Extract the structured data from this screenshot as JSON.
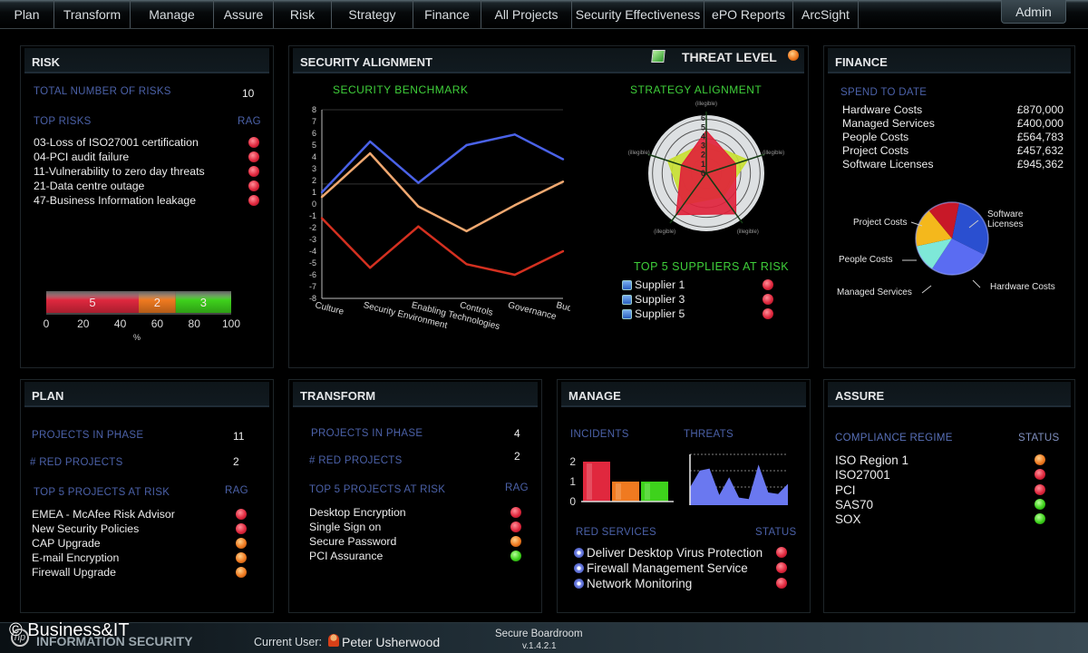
{
  "nav": {
    "tabs": [
      "Plan",
      "Transform",
      "Manage",
      "Assure",
      "Risk",
      "Strategy",
      "Finance",
      "All Projects",
      "Security Effectiveness",
      "ePO Reports",
      "ArcSight"
    ],
    "admin_label": "Admin"
  },
  "risk": {
    "title": "RISK",
    "total_label": "TOTAL NUMBER OF RISKS",
    "total_value": "10",
    "top_label": "TOP RISKS",
    "rag_label": "RAG",
    "items": [
      {
        "label": "03-Loss of ISO27001 certification",
        "status": "red"
      },
      {
        "label": "04-PCI audit failure",
        "status": "red"
      },
      {
        "label": "11-Vulnerability to zero day threats",
        "status": "red"
      },
      {
        "label": "21-Data centre outage",
        "status": "red"
      },
      {
        "label": "47-Business Information leakage",
        "status": "red"
      }
    ],
    "rag_bar": {
      "segments": [
        {
          "label": "5",
          "value": 5,
          "percent": 50,
          "color": "#e0283e"
        },
        {
          "label": "2",
          "value": 2,
          "percent": 20,
          "color": "#f07a20"
        },
        {
          "label": "3",
          "value": 3,
          "percent": 30,
          "color": "#3ed21c"
        }
      ],
      "ticks": [
        "0",
        "20",
        "40",
        "60",
        "80",
        "100"
      ],
      "xlabel": "%"
    }
  },
  "alignment": {
    "title": "SECURITY ALIGNMENT",
    "threat_label": "THREAT LEVEL",
    "threat_status": "amber",
    "benchmark_title": "SECURITY BENCHMARK",
    "strategy_title": "STRATEGY ALIGNMENT",
    "suppliers_title": "TOP 5 SUPPLIERS AT RISK",
    "suppliers": [
      {
        "label": "Supplier 1",
        "status": "red"
      },
      {
        "label": "Supplier 3",
        "status": "red"
      },
      {
        "label": "Supplier 5",
        "status": "red"
      }
    ]
  },
  "chart_data": [
    {
      "type": "line",
      "title": "SECURITY BENCHMARK",
      "categories": [
        "Culture",
        "Security Environment",
        "Enabling Technologies",
        "Controls",
        "Governance",
        "Budget"
      ],
      "ylim": [
        -8,
        8
      ],
      "yticks": [
        "8",
        "7",
        "6",
        "5",
        "4",
        "3",
        "2",
        "1",
        "0",
        "-1",
        "-2",
        "-3",
        "-4",
        "-5",
        "-6",
        "-7",
        "-8"
      ],
      "series": [
        {
          "name": "blue",
          "color": "#4a62e8",
          "values": [
            1,
            5.3,
            1.8,
            5,
            5.9,
            3.8
          ]
        },
        {
          "name": "orange",
          "color": "#f0a870",
          "values": [
            0.6,
            4.3,
            -0.2,
            -2.3,
            -0.1,
            1.9
          ]
        },
        {
          "name": "red",
          "color": "#d43020",
          "values": [
            -1.2,
            -5.4,
            -1.9,
            -5.1,
            -6,
            -4
          ]
        }
      ],
      "reference_line": 1.7
    },
    {
      "type": "radar",
      "title": "STRATEGY ALIGNMENT",
      "axes": [
        "(illegible)",
        "(illegible)",
        "(illegible)",
        "(illegible)",
        "(illegible)"
      ],
      "rings": [
        "0",
        "1",
        "2",
        "3",
        "4",
        "5",
        "6"
      ],
      "series": [
        {
          "name": "target",
          "color": "#c8e030",
          "values": [
            3.2,
            4.5,
            3,
            4,
            4.2
          ]
        },
        {
          "name": "actual",
          "color": "#e0203a",
          "values": [
            4.4,
            3.2,
            5.2,
            5.3,
            2.7
          ]
        }
      ]
    },
    {
      "type": "pie",
      "title": "SPEND TO DATE",
      "labels": [
        "Software Licenses",
        "Hardware Costs",
        "Managed Services",
        "People Costs",
        "Project Costs"
      ],
      "values": [
        945362,
        870000,
        400000,
        564783,
        457632
      ],
      "colors": [
        "#2a4fd0",
        "#5a6cf2",
        "#7ee8d8",
        "#f4b81c",
        "#c81828"
      ]
    },
    {
      "type": "bar",
      "title": "INCIDENTS",
      "categories": [
        "Red",
        "Amber",
        "Green"
      ],
      "values": [
        2,
        1,
        1
      ],
      "colors": [
        "#e0283e",
        "#f07a20",
        "#3ed21c"
      ],
      "yticks": [
        "0",
        "1",
        "2"
      ],
      "ylim": [
        0,
        2
      ]
    },
    {
      "type": "area",
      "title": "THREATS",
      "values": [
        0.35,
        0.68,
        0.72,
        0.2,
        0.55,
        0.15,
        0.12,
        0.8,
        0.25,
        0.22,
        0.42
      ],
      "ylim": [
        0,
        1
      ],
      "color": "#6a78f0"
    }
  ],
  "finance": {
    "title": "FINANCE",
    "spend_label": "SPEND TO DATE",
    "rows": [
      {
        "label": "Hardware Costs",
        "value": "£870,000"
      },
      {
        "label": "Managed Services",
        "value": "£400,000"
      },
      {
        "label": "People Costs",
        "value": "£564,783"
      },
      {
        "label": "Project Costs",
        "value": "£457,632"
      },
      {
        "label": "Software Licenses",
        "value": "£945,362"
      }
    ],
    "pie_labels": {
      "project": "Project Costs",
      "software1": "Software",
      "software2": "Licenses",
      "people": "People Costs",
      "managed": "Managed Services",
      "hardware": "Hardware Costs"
    }
  },
  "plan": {
    "title": "PLAN",
    "phase_label": "PROJECTS IN PHASE",
    "phase_value": "11",
    "red_label": "# RED PROJECTS",
    "red_value": "2",
    "top_label": "TOP 5 PROJECTS AT RISK",
    "rag_label": "RAG",
    "items": [
      {
        "label": "EMEA - McAfee Risk Advisor",
        "status": "red"
      },
      {
        "label": "New Security Policies",
        "status": "red"
      },
      {
        "label": "CAP Upgrade",
        "status": "amber"
      },
      {
        "label": "E-mail Encryption",
        "status": "amber"
      },
      {
        "label": "Firewall Upgrade",
        "status": "amber"
      }
    ]
  },
  "transform": {
    "title": "TRANSFORM",
    "phase_label": "PROJECTS IN PHASE",
    "phase_value": "4",
    "red_label": "# RED PROJECTS",
    "red_value": "2",
    "top_label": "TOP 5 PROJECTS AT RISK",
    "rag_label": "RAG",
    "items": [
      {
        "label": "Desktop Encryption",
        "status": "red"
      },
      {
        "label": "Single Sign on",
        "status": "red"
      },
      {
        "label": "Secure Password",
        "status": "amber"
      },
      {
        "label": "PCI Assurance",
        "status": "green"
      }
    ]
  },
  "manage": {
    "title": "MANAGE",
    "incidents_label": "INCIDENTS",
    "threats_label": "THREATS",
    "services_label": "RED SERVICES",
    "status_label": "STATUS",
    "services": [
      {
        "label": "Deliver Desktop Virus Protection",
        "status": "red"
      },
      {
        "label": "Firewall Management Service",
        "status": "red"
      },
      {
        "label": "Network Monitoring",
        "status": "red"
      }
    ]
  },
  "assure": {
    "title": "ASSURE",
    "regime_label": "COMPLIANCE REGIME",
    "status_label": "STATUS",
    "items": [
      {
        "label": "ISO Region 1",
        "status": "amber"
      },
      {
        "label": "ISO27001",
        "status": "red"
      },
      {
        "label": "PCI",
        "status": "red"
      },
      {
        "label": "SAS70",
        "status": "green"
      },
      {
        "label": "SOX",
        "status": "green"
      }
    ]
  },
  "footer": {
    "watermark": "© Business&IT",
    "app_name": "INFORMATION SECURITY",
    "user_label": "Current User:",
    "user_name": "Peter Usherwood",
    "product": "Secure Boardroom",
    "version": "v.1.4.2.1"
  }
}
